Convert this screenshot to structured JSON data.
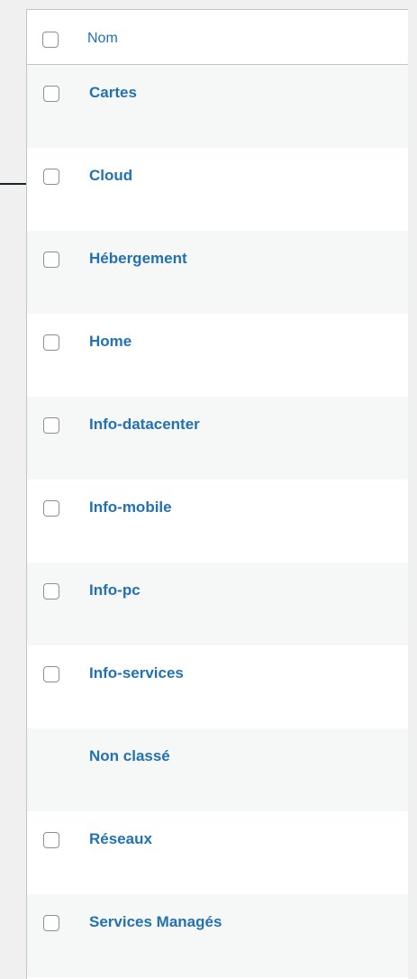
{
  "table": {
    "header": {
      "column_label": "Nom"
    },
    "rows": [
      {
        "label": "Cartes",
        "has_checkbox": true
      },
      {
        "label": "Cloud",
        "has_checkbox": true
      },
      {
        "label": "Hébergement",
        "has_checkbox": true
      },
      {
        "label": "Home",
        "has_checkbox": true
      },
      {
        "label": "Info-datacenter",
        "has_checkbox": true
      },
      {
        "label": "Info-mobile",
        "has_checkbox": true
      },
      {
        "label": "Info-pc",
        "has_checkbox": true
      },
      {
        "label": "Info-services",
        "has_checkbox": true
      },
      {
        "label": "Non classé",
        "has_checkbox": false
      },
      {
        "label": "Réseaux",
        "has_checkbox": true
      },
      {
        "label": "Services Managés",
        "has_checkbox": true
      }
    ]
  },
  "colors": {
    "link": "#2271b1",
    "border": "#c3c4c7",
    "alt_row": "#f6f7f7",
    "background": "#f0f0f1"
  }
}
